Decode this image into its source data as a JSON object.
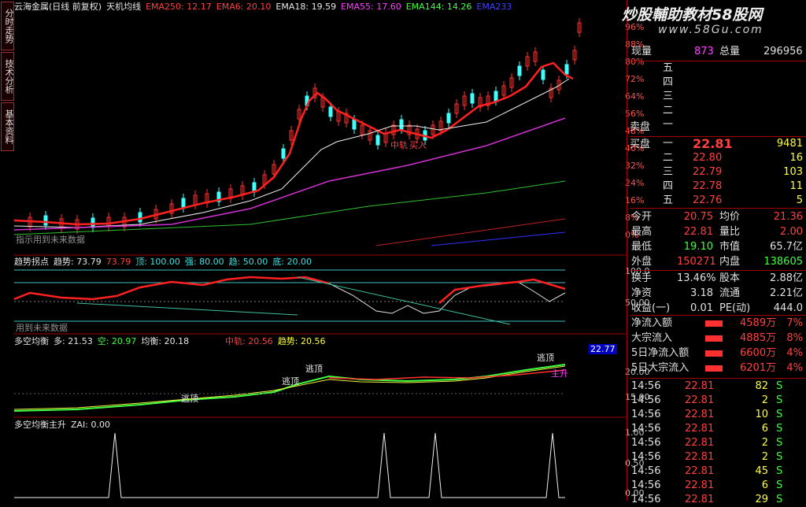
{
  "left_tabs": [
    "分时走势",
    "技术分析",
    "基本资料"
  ],
  "main_header": {
    "stock": "云海金属(日线 前复权)",
    "indicator": "天机均线",
    "ema250": "EMA250: 12.17",
    "ema6": "EMA6: 20.10",
    "ema18": "EMA18: 19.59",
    "ema55": "EMA55: 17.60",
    "ema144": "EMA144: 14.26",
    "ema_last": "EMA233"
  },
  "main_ticks": [
    "96%",
    "88%",
    "80%",
    "72%",
    "64%",
    "56%",
    "48%",
    "40%",
    "32%",
    "24%",
    "16%",
    "8%",
    "0%"
  ],
  "main_labels": {
    "warn": "指示用到未来数据",
    "mid": "中轨",
    "buy": "买入"
  },
  "p2_header": {
    "name": "趋势拐点",
    "trend": "趋势: 73.79",
    "trend2": "73.79",
    "top": "顶: 100.00",
    "strong": "强: 80.00",
    "tr": "趋: 50.00",
    "bottom": "底: 20.00"
  },
  "p2_ticks": [
    "100.0",
    "50.00"
  ],
  "p2_label": "用到未来数据",
  "p3_header": {
    "name": "多空均衡",
    "long": "多: 21.53",
    "short": "空: 20.97",
    "bal": "均衡: 20.18",
    "mid": "中轨: 20.56",
    "trend": "趋势: 20.56"
  },
  "p3_ticks": [
    "22.77",
    "20.00",
    "15.00"
  ],
  "p3_labels": {
    "a": "逃顶",
    "b": "主升"
  },
  "p4_header": {
    "name": "多空均衡主升",
    "zai": "ZAI: 0.00"
  },
  "p4_ticks": [
    "1.00",
    "0.50",
    "0.00"
  ],
  "watermark": {
    "line1": "炒股輔助教材58股网",
    "line2": "www.58Gu.com"
  },
  "quote": {
    "xianliang_label": "现量",
    "xianliang": "873",
    "zongliang_label": "总量",
    "zongliang": "296956",
    "sell_label": "卖盘",
    "sells": [
      "五",
      "四",
      "三",
      "二",
      "一"
    ],
    "buy_label": "买盘",
    "buys": [
      {
        "lv": "一",
        "p": "22.81",
        "v": "9481"
      },
      {
        "lv": "二",
        "p": "22.80",
        "v": "16"
      },
      {
        "lv": "三",
        "p": "22.79",
        "v": "103"
      },
      {
        "lv": "四",
        "p": "22.78",
        "v": "11"
      },
      {
        "lv": "五",
        "p": "22.76",
        "v": "5"
      }
    ],
    "stats": [
      {
        "k1": "今开",
        "v1": "20.75",
        "k2": "均价",
        "v2": "21.36"
      },
      {
        "k1": "最高",
        "v1": "22.81",
        "k2": "量比",
        "v2": "2.00"
      },
      {
        "k1": "最低",
        "v1": "19.10",
        "k2": "市值",
        "v2": "65.7亿"
      },
      {
        "k1": "外盘",
        "v1": "150271",
        "k2": "内盘",
        "v2": "138605"
      }
    ],
    "stats2": [
      {
        "k1": "换手",
        "v1": "13.46%",
        "k2": "股本",
        "v2": "2.88亿"
      },
      {
        "k1": "净资",
        "v1": "3.18",
        "k2": "流通",
        "v2": "2.21亿"
      },
      {
        "k1": "收益(一)",
        "v1": "0.01",
        "k2": "PE(动)",
        "v2": "444.0"
      }
    ],
    "flows": [
      {
        "k": "净流入额",
        "v": "4589万",
        "p": "7%"
      },
      {
        "k": "大宗流入",
        "v": "4885万",
        "p": "8%"
      },
      {
        "k": "5日净流入额",
        "v": "6600万",
        "p": "4%"
      },
      {
        "k": "5日大宗流入",
        "v": "6201万",
        "p": "4%"
      }
    ],
    "ticks": [
      {
        "t": "14:56",
        "p": "22.81",
        "v": "82",
        "s": "S"
      },
      {
        "t": "14:56",
        "p": "22.81",
        "v": "2",
        "s": "S"
      },
      {
        "t": "14:56",
        "p": "22.81",
        "v": "10",
        "s": "S"
      },
      {
        "t": "14:56",
        "p": "22.81",
        "v": "6",
        "s": "S"
      },
      {
        "t": "14:56",
        "p": "22.81",
        "v": "2",
        "s": "S"
      },
      {
        "t": "14:56",
        "p": "22.81",
        "v": "2",
        "s": "S"
      },
      {
        "t": "14:56",
        "p": "22.81",
        "v": "45",
        "s": "S"
      },
      {
        "t": "14:56",
        "p": "22.81",
        "v": "6",
        "s": "S"
      },
      {
        "t": "14:56",
        "p": "22.81",
        "v": "29",
        "s": "S"
      }
    ]
  }
}
